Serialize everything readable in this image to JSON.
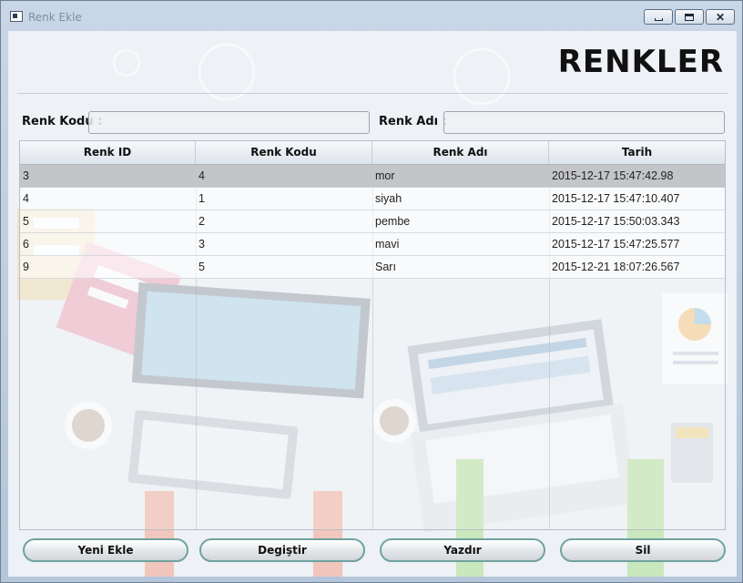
{
  "window": {
    "title": "Renk Ekle",
    "controls": {
      "minimize": "",
      "maximize": "",
      "close": "✕"
    }
  },
  "header": {
    "title": "RENKLER"
  },
  "form": {
    "code_label": "Renk Kodu :",
    "code_value": "",
    "name_label": "Renk Adı :",
    "name_value": ""
  },
  "table": {
    "columns": [
      "Renk ID",
      "Renk Kodu",
      "Renk Adı",
      "Tarih"
    ],
    "rows": [
      [
        "3",
        "4",
        "mor",
        "2015-12-17 15:47:42.98"
      ],
      [
        "4",
        "1",
        "siyah",
        "2015-12-17 15:47:10.407"
      ],
      [
        "5",
        "2",
        "pembe",
        "2015-12-17 15:50:03.343"
      ],
      [
        "6",
        "3",
        "mavi",
        "2015-12-17 15:47:25.577"
      ],
      [
        "9",
        "5",
        "Sarı",
        "2015-12-21 18:07:26.567"
      ]
    ],
    "selected_row_index": 0
  },
  "actions": {
    "new": "Yeni Ekle",
    "edit": "Degiştir",
    "print": "Yazdır",
    "delete": "Sil"
  },
  "colors": {
    "selected_row": "#c3c5c8",
    "button_border": "#6fa3a0",
    "title_bar": "#c9d6e6"
  }
}
